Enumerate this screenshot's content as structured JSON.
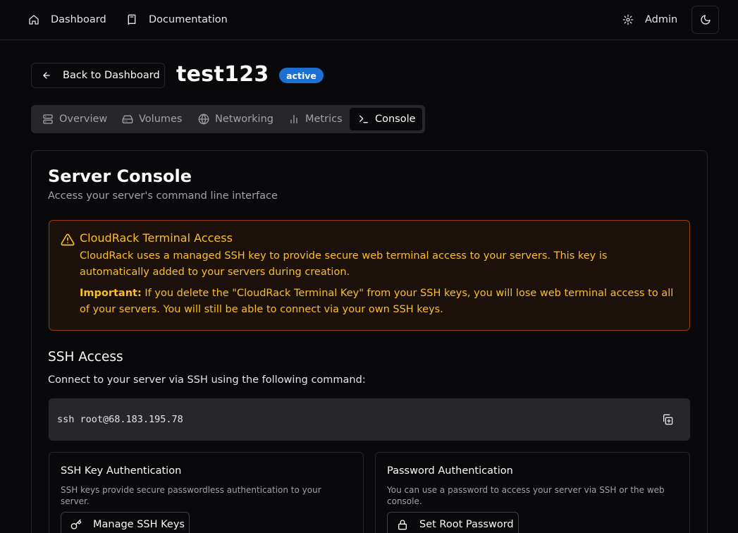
{
  "nav": {
    "dashboard": "Dashboard",
    "documentation": "Documentation",
    "admin": "Admin"
  },
  "header": {
    "back_label": "Back to Dashboard",
    "server_name": "test123",
    "status": "active"
  },
  "tabs": [
    {
      "label": "Overview",
      "icon": "server-icon"
    },
    {
      "label": "Volumes",
      "icon": "hard-drive-icon"
    },
    {
      "label": "Networking",
      "icon": "globe-icon"
    },
    {
      "label": "Metrics",
      "icon": "bar-chart-icon"
    },
    {
      "label": "Console",
      "icon": "terminal-icon",
      "active": true
    }
  ],
  "console": {
    "title": "Server Console",
    "description": "Access your server's command line interface",
    "alert": {
      "title": "CloudRack Terminal Access",
      "line1": "CloudRack uses a managed SSH key to provide secure web terminal access to your servers. This key is automatically added to your servers during creation.",
      "important_label": "Important:",
      "line2": " If you delete the \"CloudRack Terminal Key\" from your SSH keys, you will lose web terminal access to all of your servers. You will still be able to connect via your own SSH keys."
    },
    "ssh_section": {
      "title": "SSH Access",
      "description": "Connect to your server via SSH using the following command:",
      "command": "ssh root@68.183.195.78"
    },
    "key_auth": {
      "title": "SSH Key Authentication",
      "description": "SSH keys provide secure passwordless authentication to your server.",
      "button": "Manage SSH Keys"
    },
    "password_auth": {
      "title": "Password Authentication",
      "description": "You can use a password to access your server via SSH or the web console.",
      "button": "Set Root Password"
    }
  },
  "colors": {
    "background": "#09090b",
    "accent_badge": "#1d6fd1",
    "warning": "#fbbf24"
  }
}
